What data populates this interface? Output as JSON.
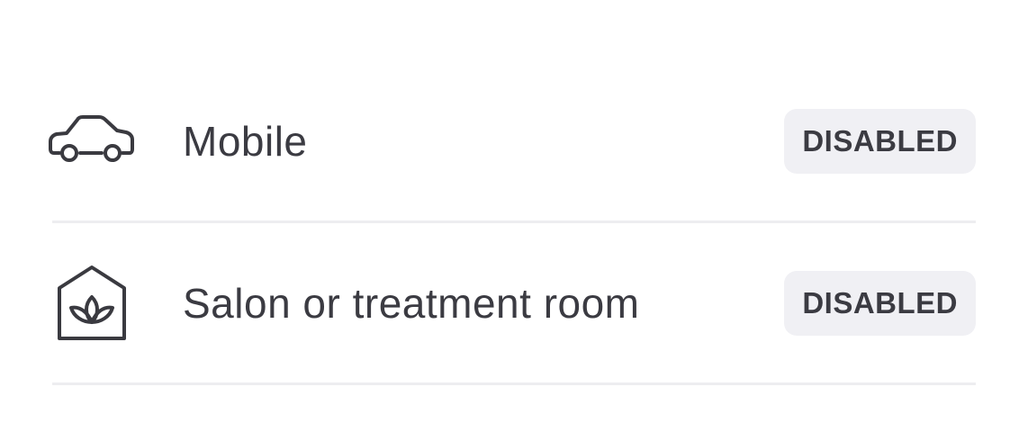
{
  "locations": [
    {
      "label": "Mobile",
      "icon": "car-icon",
      "status": "DISABLED"
    },
    {
      "label": "Salon or treatment room",
      "icon": "salon-house-icon",
      "status": "DISABLED"
    }
  ],
  "colors": {
    "text": "#3b3b42",
    "badge_background": "#f0f0f4",
    "divider": "#ededf0"
  }
}
